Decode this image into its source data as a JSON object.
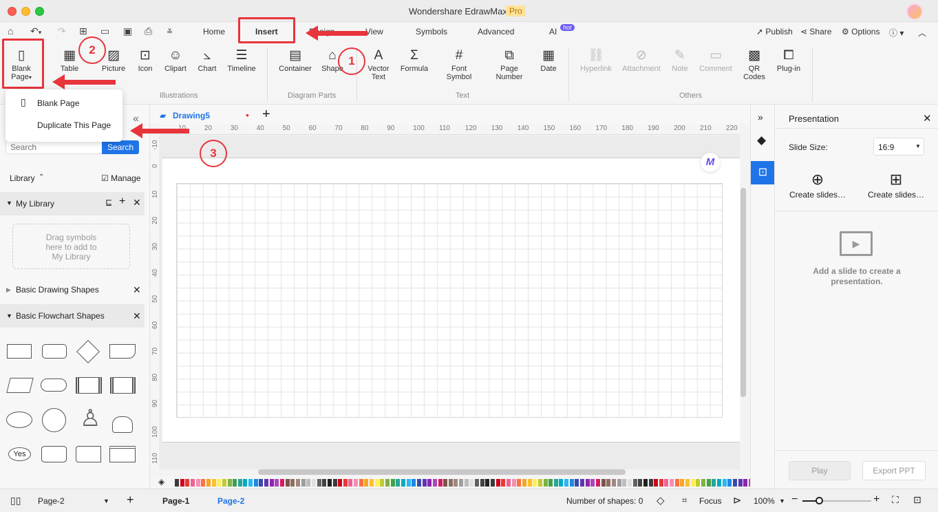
{
  "window": {
    "title": "Wondershare EdrawMax",
    "badge": "Pro"
  },
  "menu": {
    "tabs": [
      "Home",
      "Insert",
      "Design",
      "View",
      "Symbols",
      "Advanced",
      "AI"
    ],
    "ai_badge": "hot",
    "right": {
      "publish": "Publish",
      "share": "Share",
      "options": "Options"
    }
  },
  "ribbon": {
    "blank_page": "Blank\nPage",
    "table": "Table",
    "picture": "Picture",
    "icon": "Icon",
    "clipart": "Clipart",
    "chart": "Chart",
    "timeline": "Timeline",
    "container": "Container",
    "shape": "Shape",
    "vector_text": "Vector\nText",
    "formula": "Formula",
    "font_symbol": "Font\nSymbol",
    "page_number": "Page\nNumber",
    "date": "Date",
    "hyperlink": "Hyperlink",
    "attachment": "Attachment",
    "note": "Note",
    "comment": "Comment",
    "qr_codes": "QR\nCodes",
    "plugin": "Plug-in",
    "groups": {
      "illustrations": "Illustrations",
      "diagram_parts": "Diagram Parts",
      "text": "Text",
      "others": "Others"
    }
  },
  "annotations": [
    "1",
    "2",
    "3"
  ],
  "dropdown": {
    "blank_page": "Blank Page",
    "duplicate": "Duplicate This Page"
  },
  "left_panel": {
    "search_placeholder": "Search",
    "search_button": "Search",
    "library": "Library",
    "manage": "Manage",
    "my_library": "My Library",
    "drag_hint": "Drag symbols\nhere to add to\nMy Library",
    "basic_drawing": "Basic Drawing Shapes",
    "basic_flowchart": "Basic Flowchart Shapes",
    "yes_shape": "Yes"
  },
  "canvas": {
    "doc_tab": "Drawing5",
    "ruler_h": [
      "10",
      "20",
      "30",
      "40",
      "50",
      "60",
      "70",
      "80",
      "90",
      "100",
      "110",
      "120",
      "130",
      "140",
      "150",
      "160",
      "170",
      "180",
      "190",
      "200",
      "210",
      "220"
    ],
    "ruler_v": [
      "-10",
      "0",
      "10",
      "20",
      "30",
      "40",
      "50",
      "60",
      "70",
      "80",
      "90",
      "100",
      "110"
    ]
  },
  "colors": [
    "#3b3b3b",
    "#d0021b",
    "#e53935",
    "#f06292",
    "#f48fb1",
    "#ff7043",
    "#f5a623",
    "#fbc02d",
    "#ffee58",
    "#c0ca33",
    "#7cb342",
    "#43a047",
    "#26a69a",
    "#00acc1",
    "#29b6f6",
    "#1e88e5",
    "#3949ab",
    "#5e35b1",
    "#8e24aa",
    "#ab47bc",
    "#d81b60",
    "#795548",
    "#8d6e63",
    "#a1887f",
    "#9e9e9e",
    "#bdbdbd",
    "#e0e0e0",
    "#616161",
    "#424242",
    "#212121"
  ],
  "right_panel": {
    "title": "Presentation",
    "slide_size_label": "Slide Size:",
    "slide_size_value": "16:9",
    "create1": "Create slides…",
    "create2": "Create slides…",
    "empty_hint": "Add a slide to create a presentation.",
    "play": "Play",
    "export": "Export PPT"
  },
  "status": {
    "page_select": "Page-2",
    "page1": "Page-1",
    "page2": "Page-2",
    "shapes": "Number of shapes: 0",
    "focus": "Focus",
    "zoom": "100%"
  }
}
